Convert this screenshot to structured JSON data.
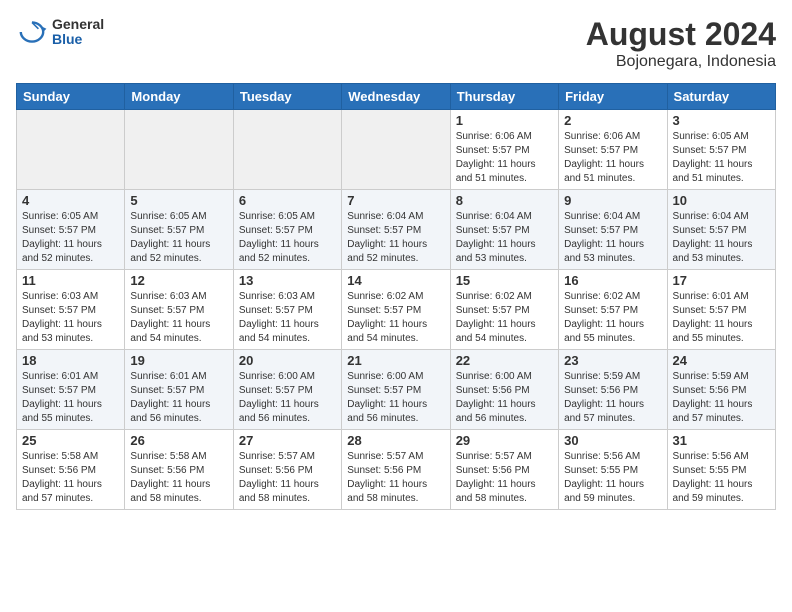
{
  "header": {
    "logo": {
      "general": "General",
      "blue": "Blue"
    },
    "title": "August 2024",
    "subtitle": "Bojonegara, Indonesia"
  },
  "calendar": {
    "days_of_week": [
      "Sunday",
      "Monday",
      "Tuesday",
      "Wednesday",
      "Thursday",
      "Friday",
      "Saturday"
    ],
    "weeks": [
      [
        {
          "day": "",
          "info": ""
        },
        {
          "day": "",
          "info": ""
        },
        {
          "day": "",
          "info": ""
        },
        {
          "day": "",
          "info": ""
        },
        {
          "day": "1",
          "info": "Sunrise: 6:06 AM\nSunset: 5:57 PM\nDaylight: 11 hours and 51 minutes."
        },
        {
          "day": "2",
          "info": "Sunrise: 6:06 AM\nSunset: 5:57 PM\nDaylight: 11 hours and 51 minutes."
        },
        {
          "day": "3",
          "info": "Sunrise: 6:05 AM\nSunset: 5:57 PM\nDaylight: 11 hours and 51 minutes."
        }
      ],
      [
        {
          "day": "4",
          "info": "Sunrise: 6:05 AM\nSunset: 5:57 PM\nDaylight: 11 hours and 52 minutes."
        },
        {
          "day": "5",
          "info": "Sunrise: 6:05 AM\nSunset: 5:57 PM\nDaylight: 11 hours and 52 minutes."
        },
        {
          "day": "6",
          "info": "Sunrise: 6:05 AM\nSunset: 5:57 PM\nDaylight: 11 hours and 52 minutes."
        },
        {
          "day": "7",
          "info": "Sunrise: 6:04 AM\nSunset: 5:57 PM\nDaylight: 11 hours and 52 minutes."
        },
        {
          "day": "8",
          "info": "Sunrise: 6:04 AM\nSunset: 5:57 PM\nDaylight: 11 hours and 53 minutes."
        },
        {
          "day": "9",
          "info": "Sunrise: 6:04 AM\nSunset: 5:57 PM\nDaylight: 11 hours and 53 minutes."
        },
        {
          "day": "10",
          "info": "Sunrise: 6:04 AM\nSunset: 5:57 PM\nDaylight: 11 hours and 53 minutes."
        }
      ],
      [
        {
          "day": "11",
          "info": "Sunrise: 6:03 AM\nSunset: 5:57 PM\nDaylight: 11 hours and 53 minutes."
        },
        {
          "day": "12",
          "info": "Sunrise: 6:03 AM\nSunset: 5:57 PM\nDaylight: 11 hours and 54 minutes."
        },
        {
          "day": "13",
          "info": "Sunrise: 6:03 AM\nSunset: 5:57 PM\nDaylight: 11 hours and 54 minutes."
        },
        {
          "day": "14",
          "info": "Sunrise: 6:02 AM\nSunset: 5:57 PM\nDaylight: 11 hours and 54 minutes."
        },
        {
          "day": "15",
          "info": "Sunrise: 6:02 AM\nSunset: 5:57 PM\nDaylight: 11 hours and 54 minutes."
        },
        {
          "day": "16",
          "info": "Sunrise: 6:02 AM\nSunset: 5:57 PM\nDaylight: 11 hours and 55 minutes."
        },
        {
          "day": "17",
          "info": "Sunrise: 6:01 AM\nSunset: 5:57 PM\nDaylight: 11 hours and 55 minutes."
        }
      ],
      [
        {
          "day": "18",
          "info": "Sunrise: 6:01 AM\nSunset: 5:57 PM\nDaylight: 11 hours and 55 minutes."
        },
        {
          "day": "19",
          "info": "Sunrise: 6:01 AM\nSunset: 5:57 PM\nDaylight: 11 hours and 56 minutes."
        },
        {
          "day": "20",
          "info": "Sunrise: 6:00 AM\nSunset: 5:57 PM\nDaylight: 11 hours and 56 minutes."
        },
        {
          "day": "21",
          "info": "Sunrise: 6:00 AM\nSunset: 5:57 PM\nDaylight: 11 hours and 56 minutes."
        },
        {
          "day": "22",
          "info": "Sunrise: 6:00 AM\nSunset: 5:56 PM\nDaylight: 11 hours and 56 minutes."
        },
        {
          "day": "23",
          "info": "Sunrise: 5:59 AM\nSunset: 5:56 PM\nDaylight: 11 hours and 57 minutes."
        },
        {
          "day": "24",
          "info": "Sunrise: 5:59 AM\nSunset: 5:56 PM\nDaylight: 11 hours and 57 minutes."
        }
      ],
      [
        {
          "day": "25",
          "info": "Sunrise: 5:58 AM\nSunset: 5:56 PM\nDaylight: 11 hours and 57 minutes."
        },
        {
          "day": "26",
          "info": "Sunrise: 5:58 AM\nSunset: 5:56 PM\nDaylight: 11 hours and 58 minutes."
        },
        {
          "day": "27",
          "info": "Sunrise: 5:57 AM\nSunset: 5:56 PM\nDaylight: 11 hours and 58 minutes."
        },
        {
          "day": "28",
          "info": "Sunrise: 5:57 AM\nSunset: 5:56 PM\nDaylight: 11 hours and 58 minutes."
        },
        {
          "day": "29",
          "info": "Sunrise: 5:57 AM\nSunset: 5:56 PM\nDaylight: 11 hours and 58 minutes."
        },
        {
          "day": "30",
          "info": "Sunrise: 5:56 AM\nSunset: 5:55 PM\nDaylight: 11 hours and 59 minutes."
        },
        {
          "day": "31",
          "info": "Sunrise: 5:56 AM\nSunset: 5:55 PM\nDaylight: 11 hours and 59 minutes."
        }
      ]
    ]
  }
}
